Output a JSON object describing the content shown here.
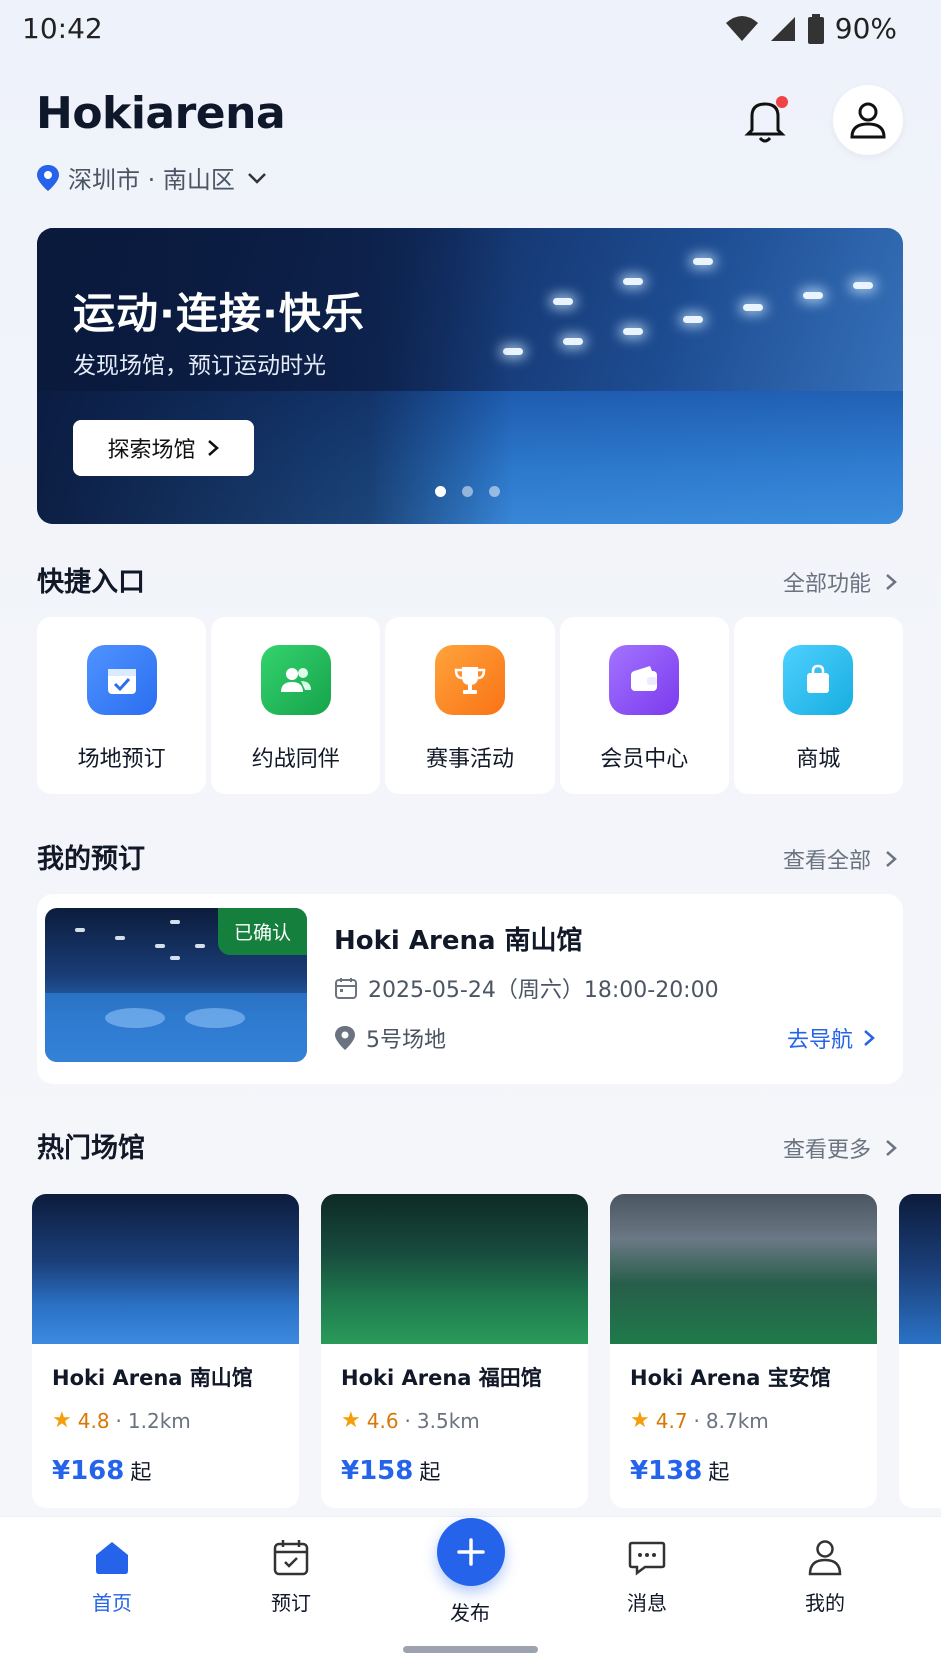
{
  "status": {
    "time": "10:42",
    "battery": "90%"
  },
  "header": {
    "title": "Hokiarena",
    "location": "深圳市 · 南山区"
  },
  "banner": {
    "headline": "运动·连接·快乐",
    "subtitle": "发现场馆，预订运动时光",
    "cta": "探索场馆"
  },
  "quick": {
    "title": "快捷入口",
    "more": "全部功能",
    "items": [
      {
        "label": "场地预订",
        "icon": "calendar-check-icon",
        "color": "#3b82f6"
      },
      {
        "label": "约战同伴",
        "icon": "users-icon",
        "color": "#22c55e"
      },
      {
        "label": "赛事活动",
        "icon": "trophy-icon",
        "color": "#f97316"
      },
      {
        "label": "会员中心",
        "icon": "wallet-icon",
        "color": "#8b5cf6"
      },
      {
        "label": "商城",
        "icon": "shopping-bag-icon",
        "color": "#22b8e8"
      }
    ]
  },
  "booking": {
    "title": "我的预订",
    "more": "查看全部",
    "badge": "已确认",
    "name": "Hoki Arena 南山馆",
    "datetime": "2025-05-24（周六）18:00-20:00",
    "court": "5号场地",
    "nav": "去导航"
  },
  "venues": {
    "title": "热门场馆",
    "more": "查看更多",
    "items": [
      {
        "name": "Hoki Arena 南山馆",
        "rating": "4.8",
        "distance": "1.2km",
        "price": "¥168",
        "suffix": "起"
      },
      {
        "name": "Hoki Arena 福田馆",
        "rating": "4.6",
        "distance": "3.5km",
        "price": "¥158",
        "suffix": "起"
      },
      {
        "name": "Hoki Arena 宝安馆",
        "rating": "4.7",
        "distance": "8.7km",
        "price": "¥138",
        "suffix": "起"
      }
    ]
  },
  "tabs": [
    {
      "label": "首页"
    },
    {
      "label": "预订"
    },
    {
      "label": "发布"
    },
    {
      "label": "消息"
    },
    {
      "label": "我的"
    }
  ],
  "colors": {
    "accent": "#2563eb",
    "badge": "#15803d",
    "star": "#f59e0b"
  }
}
